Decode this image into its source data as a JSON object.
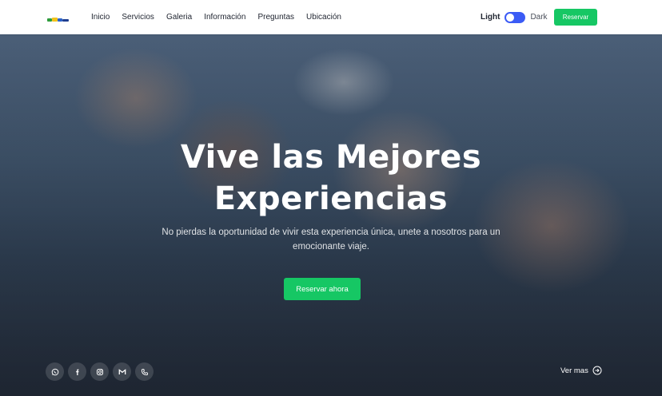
{
  "nav": {
    "links": [
      "Inicio",
      "Servicios",
      "Galeria",
      "Información",
      "Preguntas",
      "Ubicación"
    ],
    "theme_light": "Light",
    "theme_dark": "Dark",
    "reserve_label": "Reservar"
  },
  "hero": {
    "title_line1": "Vive las Mejores",
    "title_line2": "Experiencias",
    "subtitle": "No pierdas la oportunidad de vivir esta experiencia única, unete a nosotros para un emocionante viaje.",
    "cta_label": "Reservar ahora",
    "ver_mas_label": "Ver mas"
  },
  "socials": [
    "whatsapp-icon",
    "facebook-icon",
    "instagram-icon",
    "gmail-icon",
    "phone-icon"
  ],
  "colors": {
    "accent_green": "#16c764",
    "toggle_blue": "#3b5bf5",
    "nav_text": "#1f2430"
  }
}
